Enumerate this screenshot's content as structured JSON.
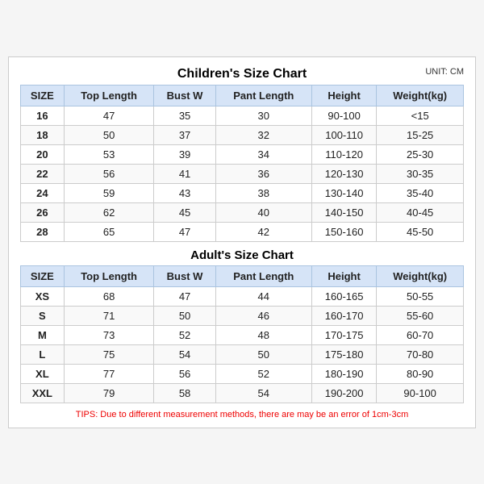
{
  "children_title": "Children's Size Chart",
  "adult_title": "Adult's Size Chart",
  "unit": "UNIT: CM",
  "children_headers": [
    "SIZE",
    "Top Length",
    "Bust W",
    "Pant Length",
    "Height",
    "Weight(kg)"
  ],
  "children_rows": [
    [
      "16",
      "47",
      "35",
      "30",
      "90-100",
      "<15"
    ],
    [
      "18",
      "50",
      "37",
      "32",
      "100-110",
      "15-25"
    ],
    [
      "20",
      "53",
      "39",
      "34",
      "110-120",
      "25-30"
    ],
    [
      "22",
      "56",
      "41",
      "36",
      "120-130",
      "30-35"
    ],
    [
      "24",
      "59",
      "43",
      "38",
      "130-140",
      "35-40"
    ],
    [
      "26",
      "62",
      "45",
      "40",
      "140-150",
      "40-45"
    ],
    [
      "28",
      "65",
      "47",
      "42",
      "150-160",
      "45-50"
    ]
  ],
  "adult_headers": [
    "SIZE",
    "Top Length",
    "Bust W",
    "Pant Length",
    "Height",
    "Weight(kg)"
  ],
  "adult_rows": [
    [
      "XS",
      "68",
      "47",
      "44",
      "160-165",
      "50-55"
    ],
    [
      "S",
      "71",
      "50",
      "46",
      "160-170",
      "55-60"
    ],
    [
      "M",
      "73",
      "52",
      "48",
      "170-175",
      "60-70"
    ],
    [
      "L",
      "75",
      "54",
      "50",
      "175-180",
      "70-80"
    ],
    [
      "XL",
      "77",
      "56",
      "52",
      "180-190",
      "80-90"
    ],
    [
      "XXL",
      "79",
      "58",
      "54",
      "190-200",
      "90-100"
    ]
  ],
  "tips": "TIPS: Due to different measurement methods, there are may be an error of 1cm-3cm"
}
